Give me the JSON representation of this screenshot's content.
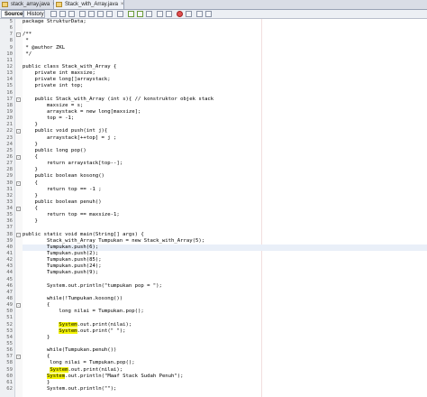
{
  "tabs": [
    {
      "label": "stack_array.java",
      "active": false
    },
    {
      "label": "Stack_with_Array.java",
      "active": true
    }
  ],
  "toolbar": {
    "source": "Source",
    "history": "History"
  },
  "code_lines": [
    {
      "n": 5,
      "text": "package StrukturData;",
      "fold": ""
    },
    {
      "n": 6,
      "text": "",
      "fold": ""
    },
    {
      "n": 7,
      "text": "/**",
      "fold": "-"
    },
    {
      "n": 8,
      "text": " *",
      "fold": ""
    },
    {
      "n": 9,
      "text": " * @author ZKL",
      "fold": ""
    },
    {
      "n": 10,
      "text": " */",
      "fold": ""
    },
    {
      "n": 11,
      "text": "",
      "fold": ""
    },
    {
      "n": 12,
      "text": "public class Stack_with_Array {",
      "fold": ""
    },
    {
      "n": 13,
      "text": "    private int maxsize;",
      "fold": ""
    },
    {
      "n": 14,
      "text": "    private long[]arraystack;",
      "fold": ""
    },
    {
      "n": 15,
      "text": "    private int top;",
      "fold": ""
    },
    {
      "n": 16,
      "text": "",
      "fold": ""
    },
    {
      "n": 17,
      "text": "    public Stack_with_Array (int s){ // konstruktor objek stack",
      "fold": "-"
    },
    {
      "n": 18,
      "text": "        maxsize = s;",
      "fold": ""
    },
    {
      "n": 19,
      "text": "        arraystack = new long[maxsize];",
      "fold": ""
    },
    {
      "n": 20,
      "text": "        top = -1;",
      "fold": ""
    },
    {
      "n": 21,
      "text": "    }",
      "fold": ""
    },
    {
      "n": 22,
      "text": "    public void push(int j){",
      "fold": "-"
    },
    {
      "n": 23,
      "text": "        arraystack[++top] = j ;",
      "fold": ""
    },
    {
      "n": 24,
      "text": "    }",
      "fold": ""
    },
    {
      "n": 25,
      "text": "    public long pop()",
      "fold": ""
    },
    {
      "n": 26,
      "text": "    {",
      "fold": "-"
    },
    {
      "n": 27,
      "text": "        return arraystack[top--];",
      "fold": ""
    },
    {
      "n": 28,
      "text": "    }",
      "fold": ""
    },
    {
      "n": 29,
      "text": "    public boolean kosong()",
      "fold": ""
    },
    {
      "n": 30,
      "text": "    {",
      "fold": "-"
    },
    {
      "n": 31,
      "text": "        return top == -1 ;",
      "fold": ""
    },
    {
      "n": 32,
      "text": "    }",
      "fold": ""
    },
    {
      "n": 33,
      "text": "    public boolean penuh()",
      "fold": ""
    },
    {
      "n": 34,
      "text": "    {",
      "fold": "-"
    },
    {
      "n": 35,
      "text": "        return top == maxsize-1;",
      "fold": ""
    },
    {
      "n": 36,
      "text": "    }",
      "fold": ""
    },
    {
      "n": 37,
      "text": "",
      "fold": ""
    },
    {
      "n": 38,
      "text": "public static void main(String[] args) {",
      "fold": "-"
    },
    {
      "n": 39,
      "text": "        Stack_with_Array Tumpukan = new Stack_with_Array(5);",
      "fold": ""
    },
    {
      "n": 40,
      "text": "        Tumpukan.push(6);",
      "fold": "",
      "hl": true
    },
    {
      "n": 41,
      "text": "        Tumpukan.push(2);",
      "fold": ""
    },
    {
      "n": 42,
      "text": "        Tumpukan.push(85);",
      "fold": ""
    },
    {
      "n": 43,
      "text": "        Tumpukan.push(24);",
      "fold": ""
    },
    {
      "n": 44,
      "text": "        Tumpukan.push(9);",
      "fold": ""
    },
    {
      "n": 45,
      "text": "",
      "fold": ""
    },
    {
      "n": 46,
      "text": "        System.out.println(\"tumpukan pop = \");",
      "fold": ""
    },
    {
      "n": 47,
      "text": "",
      "fold": ""
    },
    {
      "n": 48,
      "text": "        while(!Tumpukan.kosong())",
      "fold": ""
    },
    {
      "n": 49,
      "text": "        {",
      "fold": "-"
    },
    {
      "n": 50,
      "text": "            long nilai = Tumpukan.pop();",
      "fold": ""
    },
    {
      "n": 51,
      "text": "",
      "fold": ""
    },
    {
      "n": 52,
      "text": "            System.out.print(nilai);",
      "fold": "",
      "sys": true
    },
    {
      "n": 53,
      "text": "            System.out.print(\" \");",
      "fold": "",
      "sys": true
    },
    {
      "n": 54,
      "text": "        }",
      "fold": ""
    },
    {
      "n": 55,
      "text": "",
      "fold": ""
    },
    {
      "n": 56,
      "text": "        while(Tumpukan.penuh())",
      "fold": ""
    },
    {
      "n": 57,
      "text": "        {",
      "fold": "-"
    },
    {
      "n": 58,
      "text": "         long nilai = Tumpukan.pop();",
      "fold": ""
    },
    {
      "n": 59,
      "text": "         System.out.print(nilai);",
      "fold": "",
      "sys": true
    },
    {
      "n": 60,
      "text": "        System.out.println(\"Maaf Stack Sudah Penuh\");",
      "fold": "",
      "sys": true
    },
    {
      "n": 61,
      "text": "        }",
      "fold": ""
    },
    {
      "n": 62,
      "text": "        System.out.println(\"\");",
      "fold": ""
    }
  ]
}
